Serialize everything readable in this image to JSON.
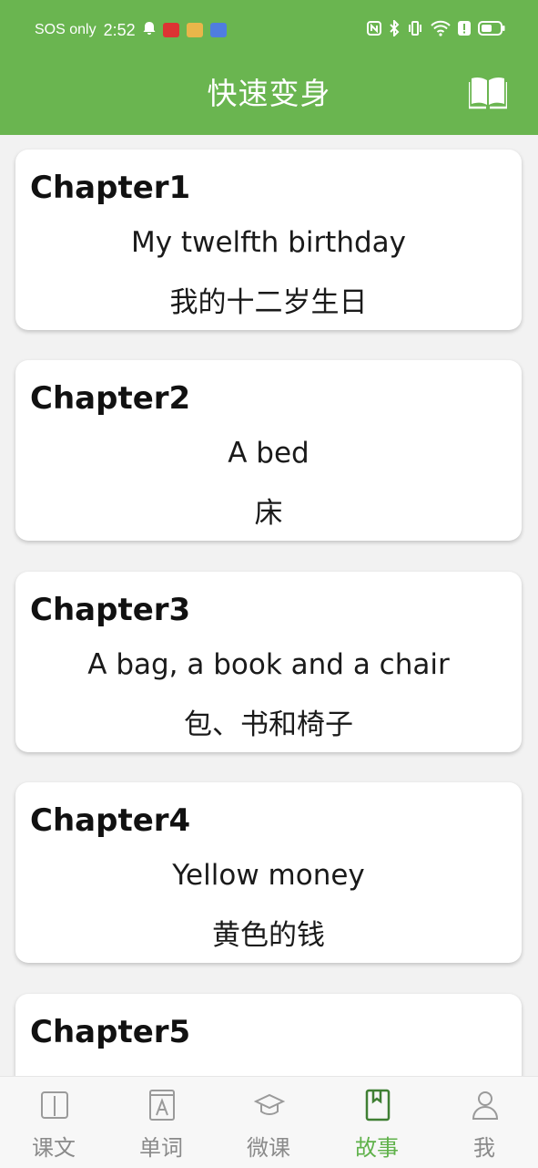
{
  "status_bar": {
    "carrier": "SOS only",
    "time": "2:52"
  },
  "header": {
    "title": "快速变身",
    "book_icon": "book-open-icon"
  },
  "chapters": [
    {
      "label": "Chapter1",
      "english": "My twelfth birthday",
      "chinese": "我的十二岁生日"
    },
    {
      "label": "Chapter2",
      "english": "A bed",
      "chinese": "床"
    },
    {
      "label": "Chapter3",
      "english": "A bag, a book and a chair",
      "chinese": "包、书和椅子"
    },
    {
      "label": "Chapter4",
      "english": "Yellow money",
      "chinese": "黄色的钱"
    },
    {
      "label": "Chapter5",
      "english": "",
      "chinese": ""
    }
  ],
  "bottom_nav": {
    "active": "故事",
    "items": [
      {
        "label": "课文",
        "icon": "book-icon"
      },
      {
        "label": "单词",
        "icon": "letter-a-icon"
      },
      {
        "label": "微课",
        "icon": "graduation-cap-icon"
      },
      {
        "label": "故事",
        "icon": "bookmark-book-icon"
      },
      {
        "label": "我",
        "icon": "person-icon"
      }
    ]
  },
  "colors": {
    "brand_green": "#6ab550",
    "active_tab": "#5fb14a",
    "inactive_tab": "#8a8a8a",
    "background": "#f2f2f2"
  }
}
